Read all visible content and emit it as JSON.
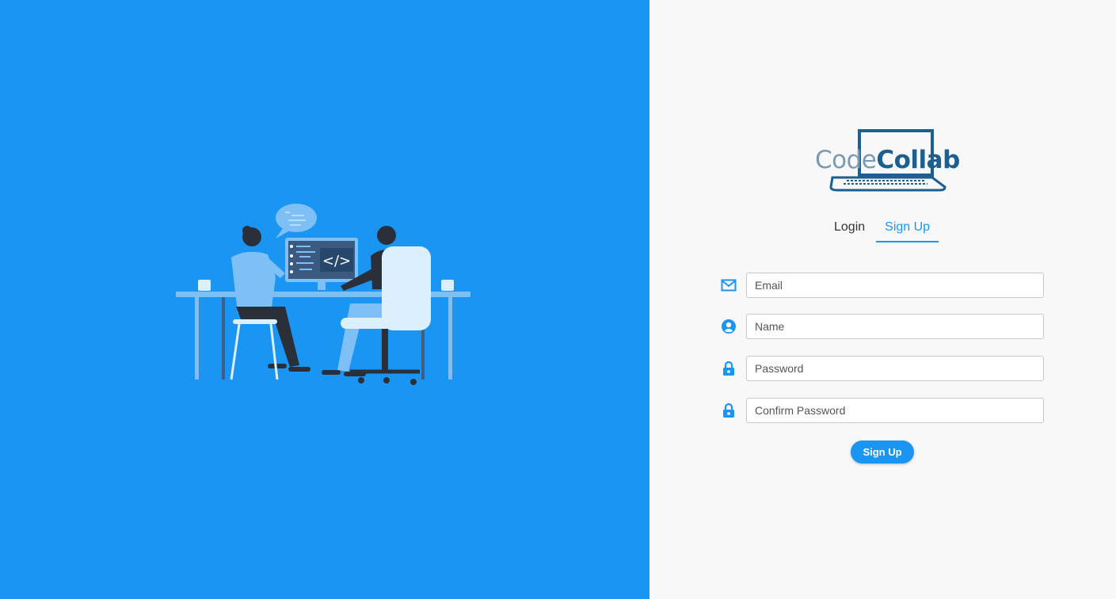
{
  "colors": {
    "brand": "#1b95f2",
    "left_panel_bg": "#1b95f2",
    "right_panel_bg": "#f8f8f8",
    "logo_code": "#7b9ab3",
    "logo_collab": "#1d5f8e"
  },
  "illustration": {
    "icon": "developers-at-desk-illustration",
    "monitor_code_glyph": "</>"
  },
  "logo": {
    "part1": "Code",
    "part2": "Collab",
    "icon": "laptop-icon"
  },
  "tabs": [
    {
      "label": "Login",
      "active": false
    },
    {
      "label": "Sign Up",
      "active": true
    }
  ],
  "form": {
    "email": {
      "placeholder": "Email",
      "value": "",
      "icon": "mail-icon"
    },
    "name": {
      "placeholder": "Name",
      "value": "",
      "icon": "user-circle-icon"
    },
    "password": {
      "placeholder": "Password",
      "value": "",
      "icon": "lock-icon"
    },
    "confirm_password": {
      "placeholder": "Confirm Password",
      "value": "",
      "icon": "lock-icon"
    },
    "submit_label": "Sign Up"
  }
}
